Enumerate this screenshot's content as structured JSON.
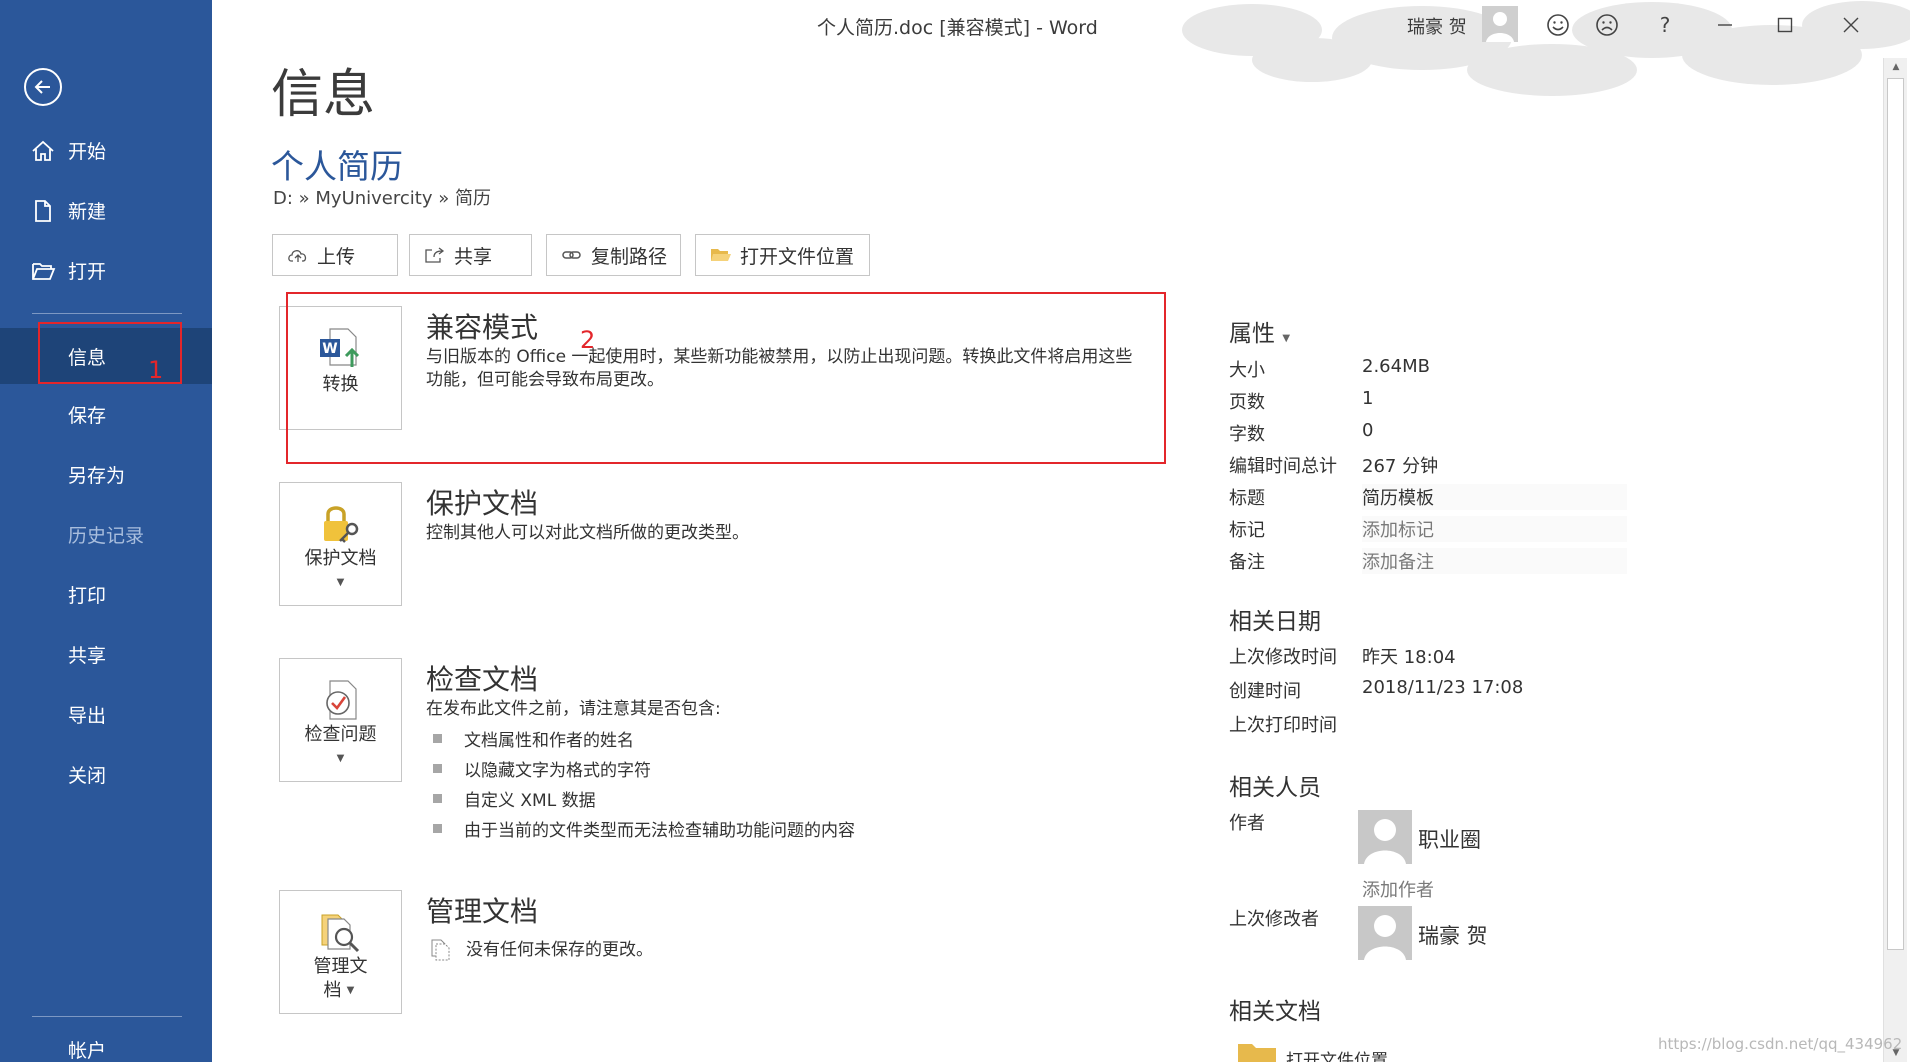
{
  "window": {
    "title": "个人简历.doc [兼容模式]  -  Word",
    "user_name": "瑞豪 贺",
    "help_label": "?"
  },
  "sidebar": {
    "items": [
      {
        "label": "开始"
      },
      {
        "label": "新建"
      },
      {
        "label": "打开"
      },
      {
        "label": "信息"
      },
      {
        "label": "保存"
      },
      {
        "label": "另存为"
      },
      {
        "label": "历史记录"
      },
      {
        "label": "打印"
      },
      {
        "label": "共享"
      },
      {
        "label": "导出"
      },
      {
        "label": "关闭"
      },
      {
        "label": "帐户"
      }
    ],
    "selected_index": 3
  },
  "annotations": {
    "marker_1": "1",
    "marker_2": "2",
    "color": "#e3262b"
  },
  "main": {
    "page_title": "信息",
    "doc_title": "个人简历",
    "breadcrumb": "D: » MyUnivercity » 简历",
    "actions": [
      {
        "label": "上传",
        "icon": "cloud-upload-icon"
      },
      {
        "label": "共享",
        "icon": "share-icon"
      },
      {
        "label": "复制路径",
        "icon": "link-icon"
      },
      {
        "label": "打开文件位置",
        "icon": "folder-open-icon"
      }
    ],
    "sections": {
      "compat": {
        "tile_label": "转换",
        "title": "兼容模式",
        "desc": "与旧版本的 Office 一起使用时，某些新功能被禁用，以防止出现问题。转换此文件将启用这些功能，但可能会导致布局更改。"
      },
      "protect": {
        "tile_label": "保护文档",
        "title": "保护文档",
        "desc": "控制其他人可以对此文档所做的更改类型。"
      },
      "inspect": {
        "tile_label": "检查问题",
        "title": "检查文档",
        "desc": "在发布此文件之前，请注意其是否包含:",
        "bullets": [
          "文档属性和作者的姓名",
          "以隐藏文字为格式的字符",
          "自定义 XML 数据",
          "由于当前的文件类型而无法检查辅助功能问题的内容"
        ]
      },
      "manage": {
        "tile_label_line1": "管理文",
        "tile_label_line2": "档",
        "title": "管理文档",
        "desc": "没有任何未保存的更改。"
      }
    }
  },
  "properties": {
    "heading": "属性",
    "rows": [
      {
        "label": "大小",
        "value": "2.64MB"
      },
      {
        "label": "页数",
        "value": "1"
      },
      {
        "label": "字数",
        "value": "0"
      },
      {
        "label": "编辑时间总计",
        "value": "267 分钟"
      },
      {
        "label": "标题",
        "value": "简历模板"
      },
      {
        "label": "标记",
        "value": "添加标记"
      },
      {
        "label": "备注",
        "value": "添加备注"
      }
    ]
  },
  "dates": {
    "heading": "相关日期",
    "rows": [
      {
        "label": "上次修改时间",
        "value": "昨天 18:04"
      },
      {
        "label": "创建时间",
        "value": "2018/11/23 17:08"
      },
      {
        "label": "上次打印时间",
        "value": ""
      }
    ]
  },
  "people": {
    "heading": "相关人员",
    "author_label": "作者",
    "author_name": "职业圈",
    "add_author": "添加作者",
    "last_modified_label": "上次修改者",
    "last_modified_name": "瑞豪 贺"
  },
  "related_docs": {
    "heading": "相关文档",
    "open_location": "打开文件位置"
  },
  "watermark": "https://blog.csdn.net/qq_434962"
}
